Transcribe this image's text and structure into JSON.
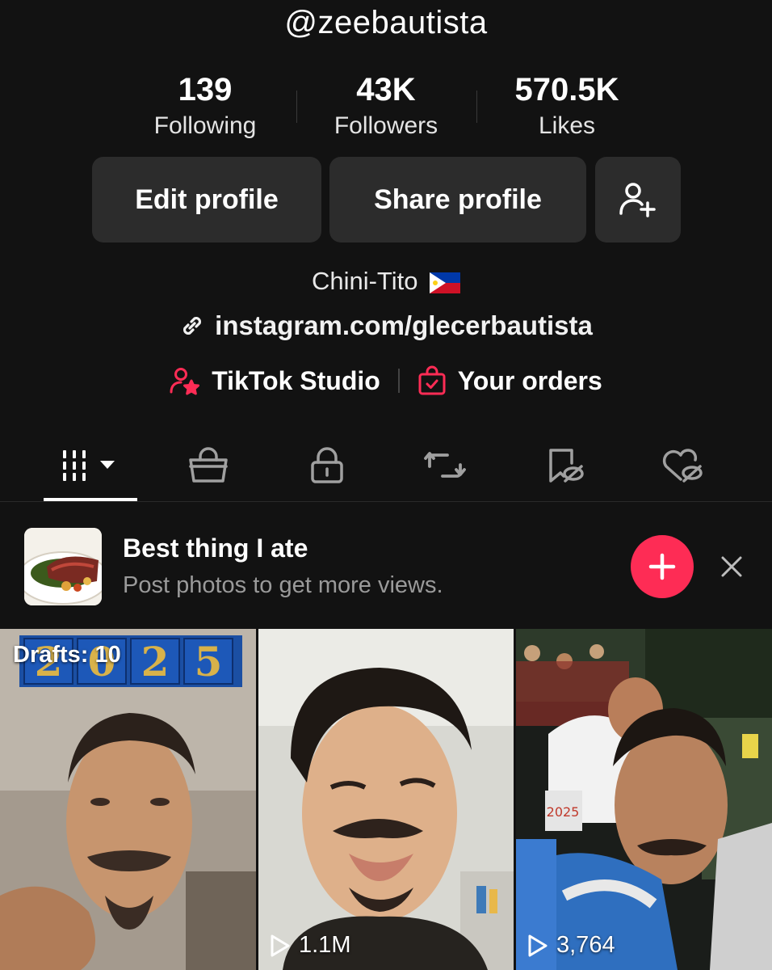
{
  "profile": {
    "username": "@zeebautista",
    "bio": "Chini-Tito",
    "bio_flag_icon": "philippines-flag-icon",
    "link": "instagram.com/glecerbautista"
  },
  "stats": [
    {
      "value": "139",
      "label": "Following"
    },
    {
      "value": "43K",
      "label": "Followers"
    },
    {
      "value": "570.5K",
      "label": "Likes"
    }
  ],
  "buttons": {
    "edit_profile": "Edit profile",
    "share_profile": "Share profile",
    "add_friend_icon": "add-user-icon"
  },
  "shortcuts": {
    "studio": "TikTok Studio",
    "orders": "Your orders"
  },
  "tabs": [
    {
      "icon": "grid-videos-icon",
      "active": true
    },
    {
      "icon": "shop-bag-icon",
      "active": false
    },
    {
      "icon": "lock-icon",
      "active": false
    },
    {
      "icon": "repost-icon",
      "active": false
    },
    {
      "icon": "hidden-favorites-icon",
      "active": false
    },
    {
      "icon": "hidden-liked-icon",
      "active": false
    }
  ],
  "promo": {
    "title": "Best thing I ate",
    "subtitle": "Post photos to get more views."
  },
  "videos": [
    {
      "overlay": "Drafts: 10",
      "views": ""
    },
    {
      "overlay": "",
      "views": "1.1M"
    },
    {
      "overlay": "",
      "views": "3,764"
    }
  ],
  "colors": {
    "background": "#121212",
    "button": "#2c2c2c",
    "accent": "#fe2c55"
  }
}
